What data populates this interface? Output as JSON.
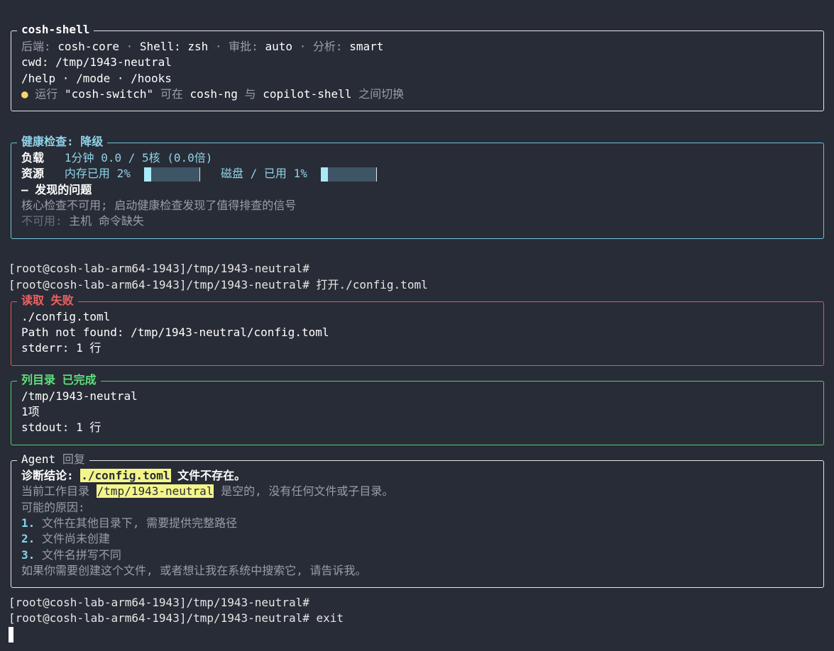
{
  "info_panel": {
    "title": "cosh-shell",
    "backend_label": "后端:",
    "backend_value": "cosh-core",
    "sep": "·",
    "shell_label": "Shell:",
    "shell_value": "zsh",
    "approval_label": "审批:",
    "approval_value": "auto",
    "analysis_label": "分析:",
    "analysis_value": "smart",
    "cwd_line": "cwd: /tmp/1943-neutral",
    "commands_line": "/help · /mode · /hooks",
    "tip_icon": "lightbulb-icon",
    "tip_prefix": "运行",
    "tip_command": "\"cosh-switch\"",
    "tip_mid": "可在",
    "tip_a": "cosh-ng",
    "tip_and": "与",
    "tip_b": "copilot-shell",
    "tip_suffix": "之间切换"
  },
  "health_panel": {
    "title": "健康检查: 降级",
    "load_label": "负载",
    "load_value": "1分钟 0.0 / 5核 (0.0倍)",
    "resource_label": "资源",
    "mem_label": "内存已用",
    "mem_value": "2%",
    "mem_fraction": 0.02,
    "disk_label": "磁盘 / 已用",
    "disk_value": "1%",
    "disk_fraction": 0.01,
    "issues_title": "— 发现的问题",
    "issue_text": "核心检查不可用; 启动健康检查发现了值得排查的信号",
    "unavailable_label": "不可用:",
    "unavailable_value": "主机 命令缺失"
  },
  "prompt": "[root@cosh-lab-arm64-1943]/tmp/1943-neutral#",
  "command_open": "打开./config.toml",
  "read_panel": {
    "title": "读取 失败",
    "line1": "./config.toml",
    "line2": "Path not found: /tmp/1943-neutral/config.toml",
    "line3": "stderr: 1 行"
  },
  "list_panel": {
    "title": "列目录 已完成",
    "line1": "/tmp/1943-neutral",
    "line2": "1项",
    "line3": "stdout: 1 行"
  },
  "agent_panel": {
    "title_en": "Agent",
    "title_cn": "回复",
    "diag_label": "诊断结论:",
    "diag_file": "./config.toml",
    "diag_rest": "文件不存在。",
    "cwd_prefix": "当前工作目录",
    "cwd_path": "/tmp/1943-neutral",
    "cwd_suffix": "是空的, 没有任何文件或子目录。",
    "reasons_title": "可能的原因:",
    "reasons": [
      {
        "num": "1.",
        "text": "文件在其他目录下, 需要提供完整路径"
      },
      {
        "num": "2.",
        "text": "文件尚未创建"
      },
      {
        "num": "3.",
        "text": "文件名拼写不同"
      }
    ],
    "closing": "如果你需要创建这个文件, 或者想让我在系统中搜索它, 请告诉我。"
  },
  "command_exit": "exit",
  "colors": {
    "background": "#282c36",
    "info_border": "#e6e6e6",
    "health_border": "#6fc4dc",
    "error_border": "#e05a5a",
    "success_border": "#4fcf6f",
    "highlight": "#f3f58a"
  }
}
